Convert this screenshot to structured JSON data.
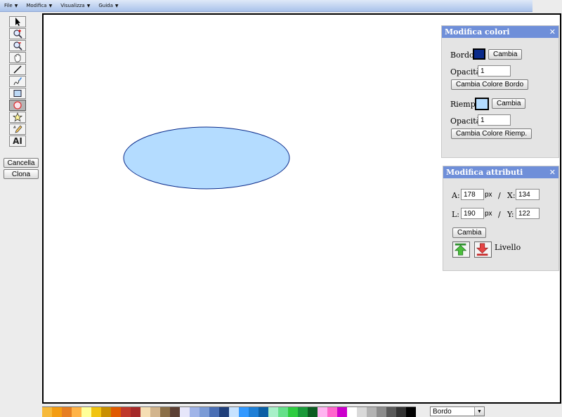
{
  "menu": [
    {
      "label": "File",
      "caret": "▼"
    },
    {
      "label": "Modifica",
      "caret": "▼"
    },
    {
      "label": "Visualizza",
      "caret": "▼"
    },
    {
      "label": "Guida",
      "caret": "▼"
    }
  ],
  "tools": [
    {
      "name": "select-tool",
      "icon": "arrow-pointer-icon"
    },
    {
      "name": "zoom-in-tool",
      "icon": "zoom-in-icon"
    },
    {
      "name": "zoom-out-tool",
      "icon": "zoom-out-icon"
    },
    {
      "name": "pan-tool",
      "icon": "hand-icon"
    },
    {
      "name": "line-tool",
      "icon": "line-icon"
    },
    {
      "name": "freehand-tool",
      "icon": "pen-icon"
    },
    {
      "name": "rect-tool",
      "icon": "rectangle-icon"
    },
    {
      "name": "ellipse-tool",
      "icon": "ellipse-icon",
      "active": true
    },
    {
      "name": "star-tool",
      "icon": "star-icon"
    },
    {
      "name": "poly-tool",
      "icon": "polygon-pencil-icon"
    },
    {
      "name": "text-tool",
      "icon": "text-icon",
      "text": "AI"
    }
  ],
  "side_buttons": {
    "delete": "Cancella",
    "clone": "Clona"
  },
  "colors_panel": {
    "title": "Modifica colori",
    "close": "✕",
    "border_label": "Bordo:",
    "border_color": "#0a2a8a",
    "change_label": "Cambia",
    "opacity_label": "Opacità:",
    "border_opacity": "1",
    "change_border_button": "Cambia Colore Bordo",
    "fill_label": "Riemp.:",
    "fill_color": "#b4dcff",
    "fill_opacity": "1",
    "change_fill_button": "Cambia Colore Riemp."
  },
  "attr_panel": {
    "title": "Modifica attributi",
    "close": "✕",
    "a_label": "A:",
    "a_value": "178",
    "l_label": "L:",
    "l_value": "190",
    "unit": "px",
    "slash": "/",
    "x_label": "X:",
    "x_value": "134",
    "y_label": "Y:",
    "y_value": "122",
    "change_button": "Cambia",
    "level_label": "Livello",
    "level_up_icon": "arrow-up-icon",
    "level_down_icon": "arrow-down-icon"
  },
  "shape": {
    "type": "ellipse",
    "fill": "#b4dcff",
    "stroke": "#0a2a8a"
  },
  "palette": {
    "colors": [
      "#f6b93b",
      "#f39c12",
      "#e67e22",
      "#ffb347",
      "#ffff99",
      "#f1c40f",
      "#c98f00",
      "#e05a00",
      "#c0392b",
      "#a52a2a",
      "#f5deb3",
      "#d2b48c",
      "#8b6f47",
      "#5c4033",
      "#e6e6fa",
      "#a0b4e8",
      "#7b9bd6",
      "#4a6fb5",
      "#1f3f7a",
      "#c6e2ff",
      "#3399ff",
      "#1e7fd6",
      "#0b5fa5",
      "#a8f0c8",
      "#66e08a",
      "#2ecc40",
      "#1a9a3a",
      "#0c5c22",
      "#ffb3f0",
      "#ff66cc",
      "#cc00cc",
      "#ffffff",
      "#d9d9d9",
      "#b3b3b3",
      "#8c8c8c",
      "#595959",
      "#333333",
      "#000000"
    ],
    "select_value": "Bordo",
    "select_arrow": "▼"
  }
}
